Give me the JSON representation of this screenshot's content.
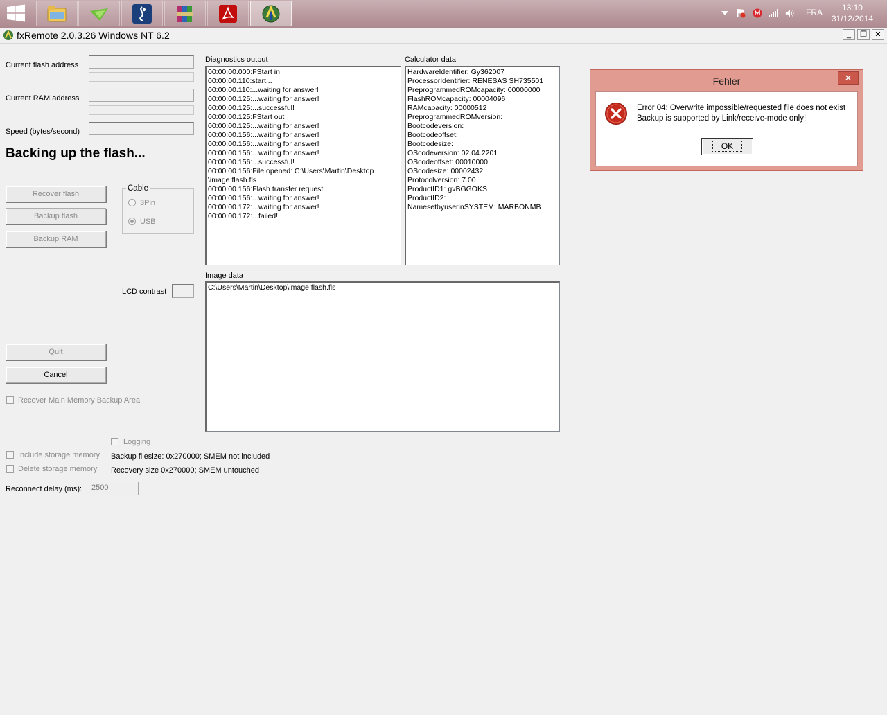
{
  "taskbar": {
    "apps": [
      {
        "name": "file-explorer",
        "active": false
      },
      {
        "name": "green-app",
        "active": false
      },
      {
        "name": "blue-app",
        "active": false
      },
      {
        "name": "winrar",
        "active": false
      },
      {
        "name": "acrobat",
        "active": false
      },
      {
        "name": "fxremote",
        "active": true
      }
    ],
    "language": "FRA",
    "time": "13:10",
    "date": "31/12/2014"
  },
  "window": {
    "title": "fxRemote 2.0.3.26 Windows NT 6.2",
    "minimize": "_",
    "restore": "❐",
    "close": "✕"
  },
  "left": {
    "flash_address_label": "Current flash address",
    "ram_address_label": "Current RAM address",
    "speed_label": "Speed (bytes/second)",
    "status": "Backing up the flash...",
    "recover_flash": "Recover flash",
    "backup_flash": "Backup flash",
    "backup_ram": "Backup RAM",
    "cable_label": "Cable",
    "cable_3pin": "3Pin",
    "cable_usb": "USB",
    "cable_selected": "USB",
    "lcd_contrast_label": "LCD contrast",
    "quit": "Quit",
    "cancel": "Cancel",
    "recover_main_memory": "Recover Main Memory Backup Area",
    "logging": "Logging",
    "include_storage": "Include storage memory",
    "delete_storage": "Delete storage memory",
    "backup_filesize": "Backup filesize: 0x270000; SMEM not included",
    "recovery_size": "Recovery size 0x270000; SMEM untouched",
    "reconnect_label": "Reconnect delay (ms):",
    "reconnect_value": "2500"
  },
  "diagnostics": {
    "label": "Diagnostics output",
    "lines": [
      "00:00:00.000:FStart in",
      "00:00:00.110:start...",
      "00:00:00.110:...waiting for answer!",
      "00:00:00.125:...waiting for answer!",
      "00:00:00.125:...successful!",
      "00:00:00.125:FStart out",
      "00:00:00.125:...waiting for answer!",
      "00:00:00.156:...waiting for answer!",
      "00:00:00.156:...waiting for answer!",
      "00:00:00.156:...waiting for answer!",
      "00:00:00.156:...successful!",
      "00:00:00.156:File opened: C:\\Users\\Martin\\Desktop",
      "\\image flash.fls",
      "00:00:00.156:Flash transfer request...",
      "00:00:00.156:...waiting for answer!",
      "00:00:00.172:...waiting for answer!",
      "00:00:00.172:...failed!"
    ]
  },
  "calculator": {
    "label": "Calculator data",
    "lines": [
      "HardwareIdentifier: Gy362007",
      "ProcessorIdentifier: RENESAS SH735501",
      "PreprogrammedROMcapacity: 00000000",
      "FlashROMcapacity: 00004096",
      "RAMcapacity: 00000512",
      "PreprogrammedROMversion:",
      "Bootcodeversion:",
      "Bootcodeoffset:",
      "Bootcodesize:",
      "OScodeversion: 02.04.2201",
      "OScodeoffset: 00010000",
      "OScodesize: 00002432",
      "Protocolversion: 7.00",
      "ProductID1: gvBGGOKS",
      "ProductID2:",
      "NamesetbyuserinSYSTEM: MARBONMB"
    ]
  },
  "image_data": {
    "label": "Image data",
    "path": "C:\\Users\\Martin\\Desktop\\image flash.fls"
  },
  "dialog": {
    "title": "Fehler",
    "close": "✕",
    "message_line1": "Error 04: Overwrite impossible/requested file does not exist",
    "message_line2": "Backup is supported by Link/receive-mode only!",
    "ok": "OK",
    "icon": "error-icon",
    "icon_color": "#c42b1c"
  }
}
